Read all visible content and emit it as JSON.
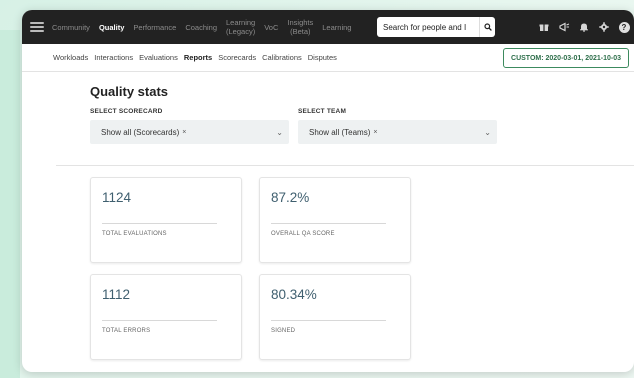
{
  "topnav": {
    "items": [
      {
        "label": "Community"
      },
      {
        "label": "Quality",
        "active": true
      },
      {
        "label": "Performance"
      },
      {
        "label": "Coaching"
      },
      {
        "line1": "Learning",
        "line2": "(Legacy)"
      },
      {
        "label": "VoC"
      },
      {
        "line1": "Insights",
        "line2": "(Beta)"
      },
      {
        "label": "Learning"
      }
    ],
    "search_placeholder": "Search for people and I",
    "search_icon": "magnifier-icon",
    "icons": [
      "gift-icon",
      "megaphone-icon",
      "bell-icon",
      "gear-icon",
      "help-icon"
    ],
    "help_glyph": "?"
  },
  "subnav": {
    "items": [
      "Workloads",
      "Interactions",
      "Evaluations",
      "Reports",
      "Scorecards",
      "Calibrations",
      "Disputes"
    ],
    "active": "Reports",
    "date_button": "CUSTOM: 2020-03-01, 2021-10-03"
  },
  "main": {
    "title": "Quality stats",
    "scorecard_label": "SELECT SCORECARD",
    "scorecard_value": "Show all (Scorecards)",
    "team_label": "SELECT TEAM",
    "team_value": "Show all (Teams)",
    "remove_glyph": "×",
    "chevron_glyph": "⌄"
  },
  "stats": [
    {
      "value": "1124",
      "caption": "TOTAL EVALUATIONS"
    },
    {
      "value": "87.2%",
      "caption": "OVERALL QA SCORE"
    },
    {
      "value": "1112",
      "caption": "TOTAL ERRORS"
    },
    {
      "value": "80.34%",
      "caption": "SIGNED"
    }
  ],
  "colors": {
    "accent": "#3c8a5e",
    "stat_value": "#3f5f6f",
    "topbar": "#222222"
  }
}
